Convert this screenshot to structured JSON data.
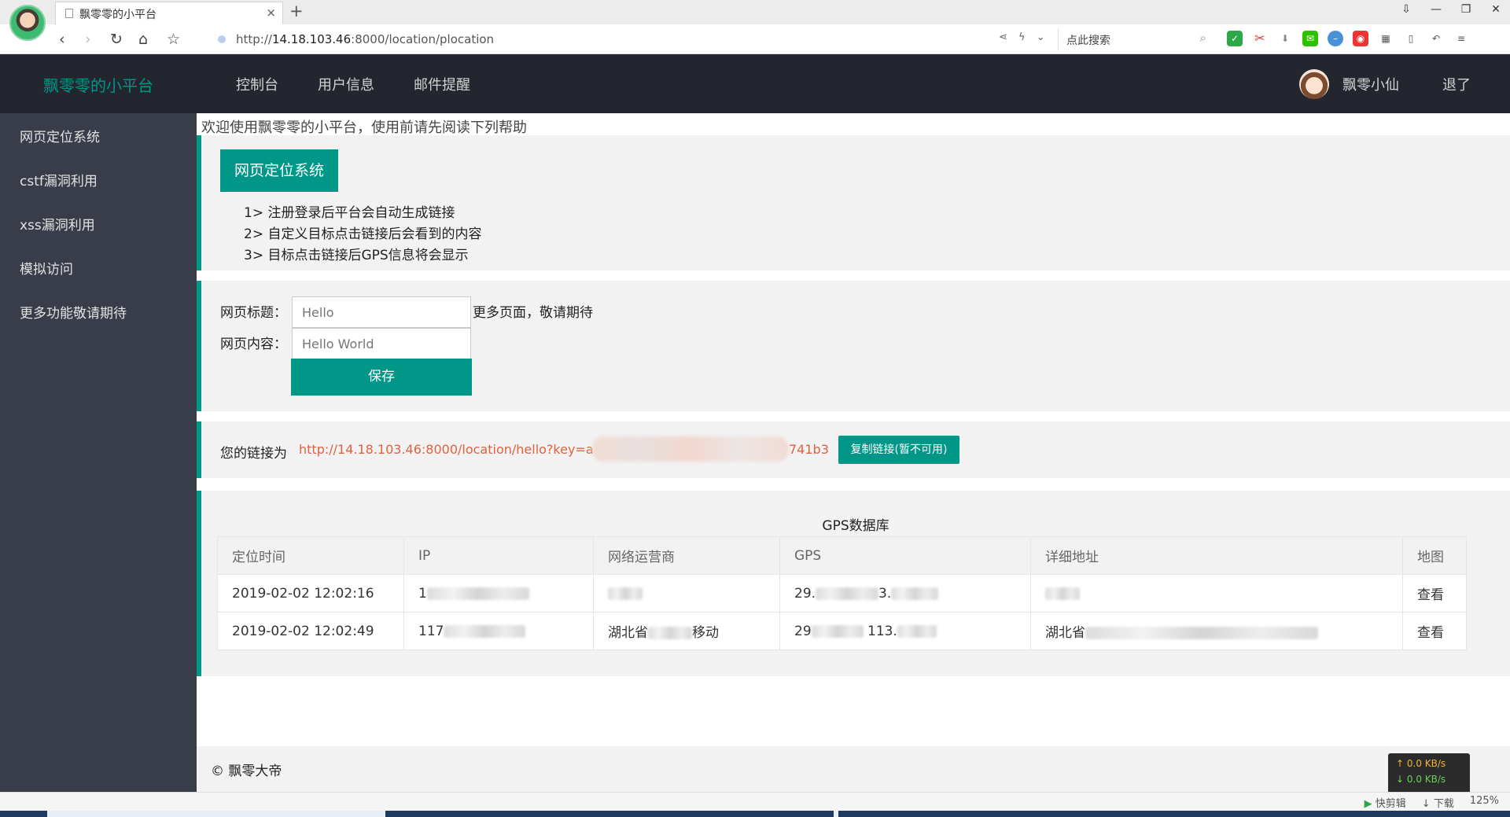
{
  "browser": {
    "tab_title": "飘零零的小平台",
    "tab_close": "×",
    "new_tab": "+",
    "url_prefix": "http://",
    "url_host": "14.18.103.46",
    "url_path": ":8000/location/plocation",
    "search_placeholder": "点此搜索",
    "window_controls": [
      "⇩",
      "—",
      "❐",
      "✕"
    ]
  },
  "header": {
    "brand": "飘零零的小平台",
    "nav": [
      "控制台",
      "用户信息",
      "邮件提醒"
    ],
    "username": "飘零小仙",
    "logout": "退了"
  },
  "sidebar": {
    "items": [
      "网页定位系统",
      "cstf漏洞利用",
      "xss漏洞利用",
      "模拟访问",
      "更多功能敬请期待"
    ]
  },
  "main": {
    "welcome": "欢迎使用飘零零的小平台，使用前请先阅读下列帮助",
    "intro_button": "网页定位系统",
    "steps": [
      "1> 注册登录后平台会自动生成链接",
      "2> 自定义目标点击链接后会看到的内容",
      "3> 目标点击链接后GPS信息将会显示"
    ],
    "form": {
      "title_label": "网页标题：",
      "title_placeholder": "Hello",
      "content_label": "网页内容：",
      "content_placeholder": "Hello World",
      "hint": "更多页面，敬请期待",
      "save": "保存"
    },
    "link": {
      "label": "您的链接为",
      "url_start": "http://14.18.103.46:8000/location/hello?key=a",
      "url_end": "741b3",
      "copy_button": "复制链接(暂不可用)"
    },
    "table": {
      "title": "GPS数据库",
      "headers": [
        "定位时间",
        "IP",
        "网络运营商",
        "GPS",
        "详细地址",
        "地图"
      ],
      "rows": [
        {
          "time": "2019-02-02 12:02:16",
          "ip": "1",
          "isp": "",
          "isp_end": "",
          "gps": "29.",
          "gps2": "3.",
          "addr": "",
          "map": "查看"
        },
        {
          "time": "2019-02-02 12:02:49",
          "ip": "117",
          "isp": "湖北省",
          "isp_end": "移动",
          "gps": "29",
          "gps2": "113.",
          "addr": "湖北省",
          "map": "查看"
        }
      ]
    },
    "footer": "© 飘零大帝"
  },
  "status": {
    "items": [
      "快剪辑",
      "下载",
      "125%"
    ],
    "net_up": "↑ 0.0 KB/s",
    "net_down": "↓ 0.0 KB/s"
  },
  "colors": {
    "accent": "#009688",
    "header_bg": "#23262e",
    "sidebar_bg": "#393d49",
    "link": "#e0623e"
  }
}
